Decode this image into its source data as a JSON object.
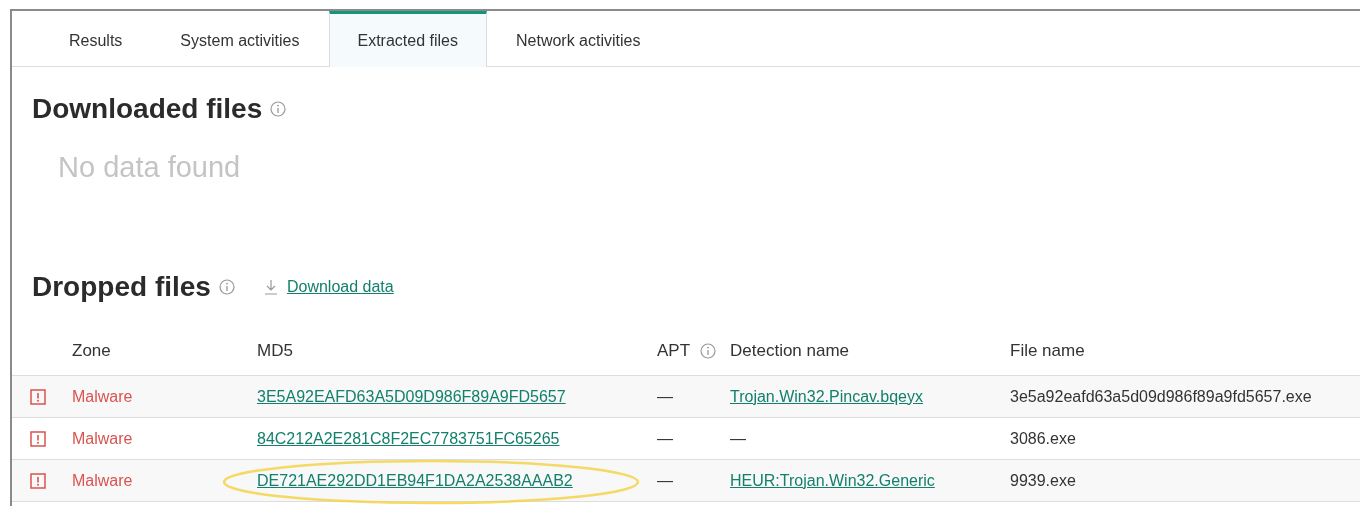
{
  "tabs": [
    {
      "label": "Results",
      "selected": false
    },
    {
      "label": "System activities",
      "selected": false
    },
    {
      "label": "Extracted files",
      "selected": true
    },
    {
      "label": "Network activities",
      "selected": false
    }
  ],
  "downloaded_files": {
    "title": "Downloaded files",
    "empty_message": "No data found"
  },
  "dropped_files": {
    "title": "Dropped files",
    "download_link": "Download data",
    "columns": [
      "Zone",
      "MD5",
      "APT",
      "Detection name",
      "File name"
    ],
    "rows": [
      {
        "zone": "Malware",
        "md5": "3E5A92EAFD63A5D09D986F89A9FD5657",
        "apt": "—",
        "detection_name": "Trojan.Win32.Pincav.bqeyx",
        "detection_is_link": true,
        "file_name": "3e5a92eafd63a5d09d986f89a9fd5657.exe",
        "circled": false
      },
      {
        "zone": "Malware",
        "md5": "84C212A2E281C8F2EC7783751FC65265",
        "apt": "—",
        "detection_name": "—",
        "detection_is_link": false,
        "file_name": "3086.exe",
        "circled": false
      },
      {
        "zone": "Malware",
        "md5": "DE721AE292DD1EB94F1DA2A2538AAAB2",
        "apt": "—",
        "detection_name": "HEUR:Trojan.Win32.Generic",
        "detection_is_link": true,
        "file_name": "9939.exe",
        "circled": true
      }
    ]
  }
}
